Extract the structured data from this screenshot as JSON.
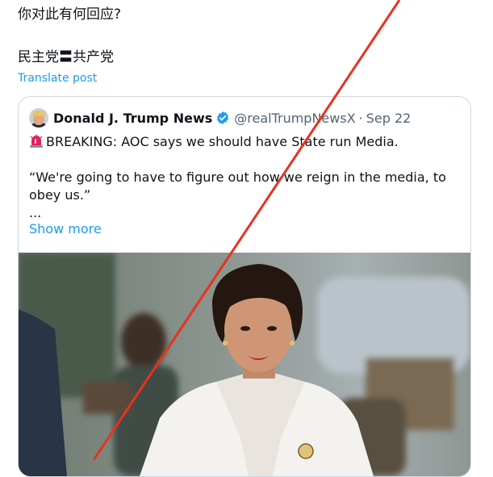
{
  "post": {
    "line1": "你对此有何回应?",
    "line2": "民主党〓共产党",
    "translate_label": "Translate post"
  },
  "quote": {
    "author_name": "Donald J. Trump News",
    "handle": "@realTrumpNewsX",
    "separator": "·",
    "date": "Sep 22",
    "breaking": "BREAKING: AOC says we should have State run Media.",
    "quote_text": "“We're going to have to figure out how we reign in the media, to obey us.”",
    "ellipsis": "...",
    "show_more": "Show more"
  },
  "icons": {
    "verified": "verified-badge-icon",
    "siren": "siren-emoji-icon"
  },
  "colors": {
    "link": "#1d9bf0",
    "text": "#0f1419",
    "secondary": "#536471",
    "border": "#cfd9de",
    "overlay_line": "#e8321e"
  }
}
